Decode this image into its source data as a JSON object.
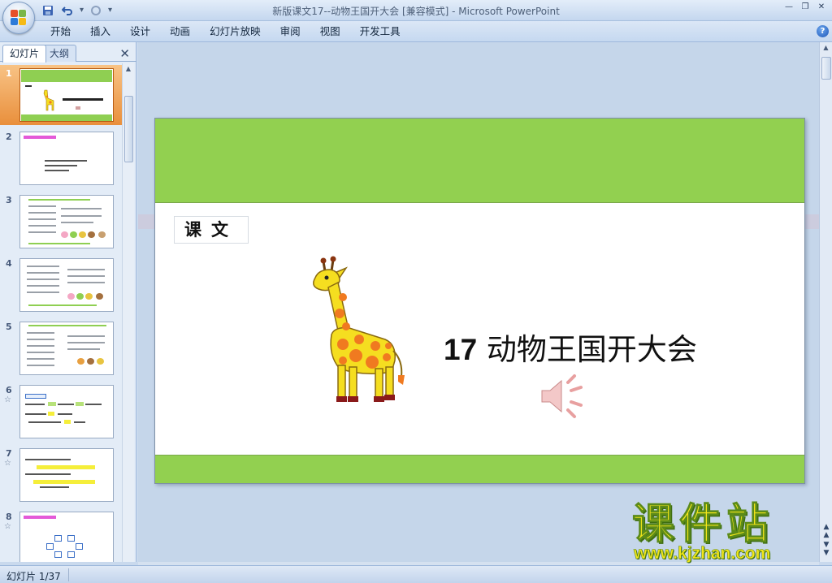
{
  "window": {
    "title": "新版课文17--动物王国开大会 [兼容模式] - Microsoft PowerPoint"
  },
  "ribbon": {
    "tabs": [
      "开始",
      "插入",
      "设计",
      "动画",
      "幻灯片放映",
      "审阅",
      "视图",
      "开发工具"
    ]
  },
  "left_pane": {
    "tabs": [
      "幻灯片",
      "大纲"
    ],
    "slides": [
      {
        "num": "1",
        "starred": false
      },
      {
        "num": "2",
        "starred": false
      },
      {
        "num": "3",
        "starred": false
      },
      {
        "num": "4",
        "starred": false
      },
      {
        "num": "5",
        "starred": false
      },
      {
        "num": "6",
        "starred": true
      },
      {
        "num": "7",
        "starred": true
      },
      {
        "num": "8",
        "starred": true
      }
    ],
    "star_glyph": "☆"
  },
  "slide": {
    "label": "课文",
    "title_number": "17",
    "title_text": "动物王国开大会",
    "colors": {
      "band": "#92d050",
      "giraffe_body": "#f5de20",
      "giraffe_spots": "#f07a20"
    }
  },
  "status": {
    "slide_indicator": "幻灯片 1/37"
  },
  "watermark": {
    "main": "课件站",
    "url": "www.kjzhan.com"
  },
  "icons": {
    "office": "office-button-icon",
    "save": "save-icon",
    "undo": "undo-icon",
    "redo": "redo-icon",
    "help": "help-icon",
    "speaker": "speaker-icon"
  }
}
